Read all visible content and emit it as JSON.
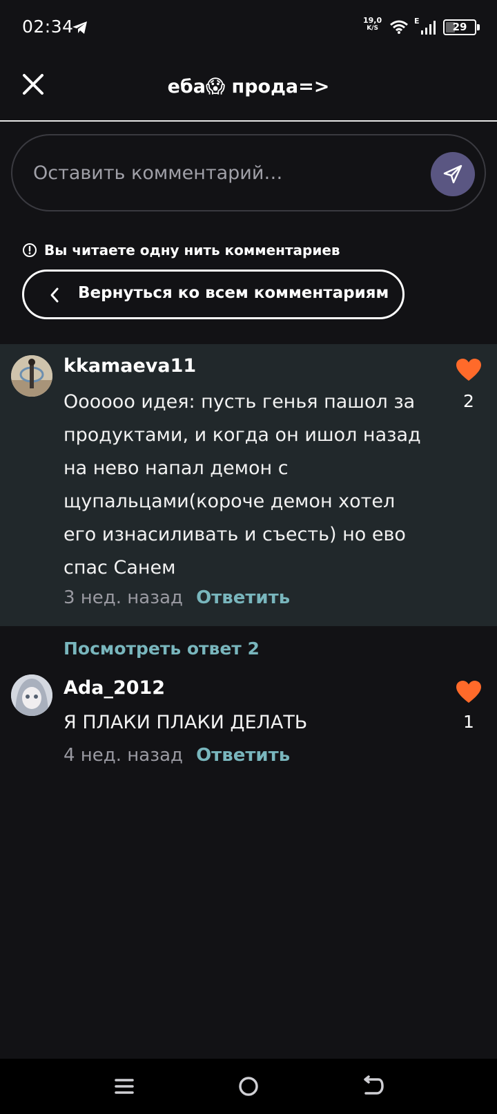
{
  "status_bar": {
    "time": "02:34",
    "net_speed_value": "19,0",
    "net_speed_unit": "K/S",
    "network_type": "E",
    "battery": "29",
    "battery_level": 0.29,
    "icons": [
      "telegram-icon",
      "wifi-icon",
      "signal-icon",
      "battery-icon"
    ]
  },
  "header": {
    "title": "еба😱 прода=>",
    "close_icon": "close-icon"
  },
  "comment_input": {
    "placeholder": "Оставить комментарий…",
    "value": "",
    "send_icon": "send-icon",
    "send_color": "#5a5682"
  },
  "thread": {
    "notice": "Вы читаете одну нить комментариев",
    "back_label": "Вернуться ко всем комментариям"
  },
  "comments": [
    {
      "username": "kkamaeva11",
      "text": "Оооооо идея: пусть генья пашол за продуктами, и когда он ишол назад на нево напал демон с щупальцами(короче демон хотел его изнасиливать и съесть) но ево спас Санем",
      "time": "3 нед. назад",
      "reply_label": "Ответить",
      "likes": "2",
      "highlighted": true
    },
    {
      "username": "Ada_2012",
      "text": "Я ПЛАКИ ПЛАКИ ДЕЛАТЬ",
      "time": "4 нед. назад",
      "reply_label": "Ответить",
      "likes": "1",
      "highlighted": false
    }
  ],
  "view_replies_label": "Посмотреть ответ 2",
  "colors": {
    "background": "#121215",
    "highlight": "#21282b",
    "accent": "#79b6bd",
    "like": "#ff6a2a"
  },
  "navbar": {
    "icons": [
      "menu-icon",
      "home-icon",
      "back-icon"
    ]
  }
}
